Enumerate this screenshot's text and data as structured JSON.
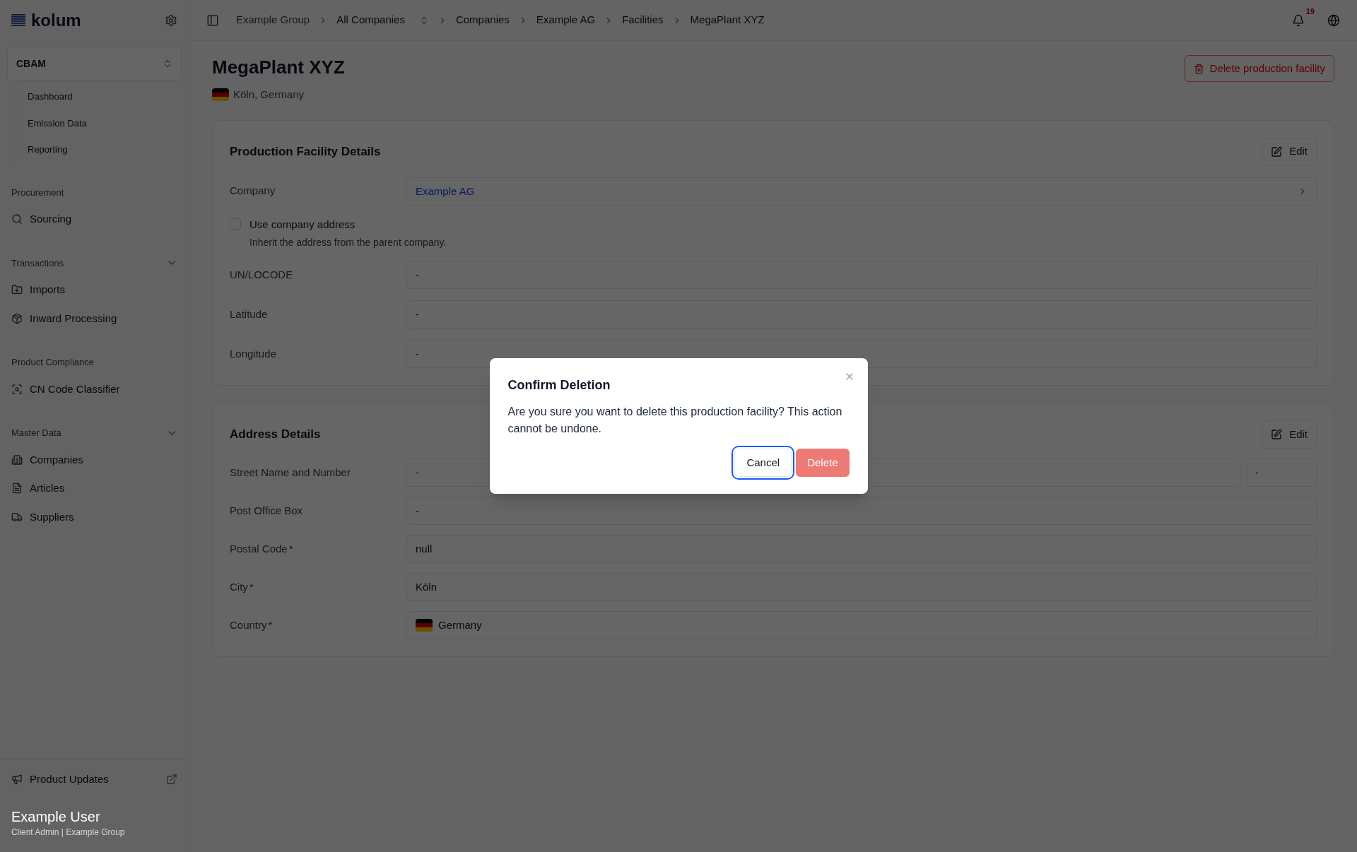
{
  "sidebar": {
    "logo": "kolum",
    "app_switcher": {
      "label": "CBAM",
      "items": [
        {
          "label": "Dashboard"
        },
        {
          "label": "Emission Data"
        },
        {
          "label": "Reporting"
        }
      ]
    },
    "sections": [
      {
        "title": "Procurement",
        "items": [
          {
            "label": "Sourcing"
          }
        ]
      },
      {
        "title": "Transactions",
        "expanded": true,
        "items": [
          {
            "label": "Imports"
          },
          {
            "label": "Inward Processing"
          }
        ]
      },
      {
        "title": "Product Compliance",
        "items": [
          {
            "label": "CN Code Classifier"
          }
        ]
      },
      {
        "title": "Master Data",
        "expanded": true,
        "items": [
          {
            "label": "Companies"
          },
          {
            "label": "Articles"
          },
          {
            "label": "Suppliers"
          }
        ]
      }
    ],
    "footer_link": "Product Updates",
    "user": {
      "name": "Example User",
      "role": "Client Admin | Example Group"
    }
  },
  "breadcrumb": [
    {
      "label": "Example Group",
      "kind": "root"
    },
    {
      "label": "All Companies",
      "kind": "switcher"
    },
    {
      "label": "Companies",
      "kind": "link"
    },
    {
      "label": "Example AG",
      "kind": "link"
    },
    {
      "label": "Facilities",
      "kind": "link"
    },
    {
      "label": "MegaPlant XYZ",
      "kind": "link"
    }
  ],
  "notifications": {
    "count": "19"
  },
  "page": {
    "title": "MegaPlant XYZ",
    "location": "Köln, Germany",
    "delete_button": "Delete production facility"
  },
  "facility_card": {
    "title": "Production Facility Details",
    "edit": "Edit",
    "company": {
      "label": "Company",
      "value": "Example AG"
    },
    "checkbox": {
      "label": "Use company address",
      "hint": "Inherit the address from the parent company.",
      "checked": false
    },
    "fields": [
      {
        "label": "UN/LOCODE",
        "value": "-"
      },
      {
        "label": "Latitude",
        "value": "-"
      },
      {
        "label": "Longitude",
        "value": "-"
      }
    ]
  },
  "address_card": {
    "title": "Address Details",
    "edit": "Edit",
    "fields": [
      {
        "label": "Street Name and Number",
        "value": "-",
        "extra": "-",
        "kind": "split"
      },
      {
        "label": "Post Office Box",
        "value": "-",
        "kind": "text"
      },
      {
        "label": "Postal Code",
        "required_mark": "*",
        "value": "null",
        "kind": "text"
      },
      {
        "label": "City",
        "required_mark": "*",
        "value": "Köln",
        "kind": "text"
      },
      {
        "label": "Country",
        "required_mark": "*",
        "value": "Germany",
        "kind": "country"
      }
    ]
  },
  "dialog": {
    "title": "Confirm Deletion",
    "message": "Are you sure you want to delete this production facility? This action cannot be undone.",
    "buttons": [
      {
        "label": "Cancel",
        "kind": "secondary",
        "focused": true
      },
      {
        "label": "Delete",
        "kind": "danger",
        "focused": false
      }
    ]
  }
}
